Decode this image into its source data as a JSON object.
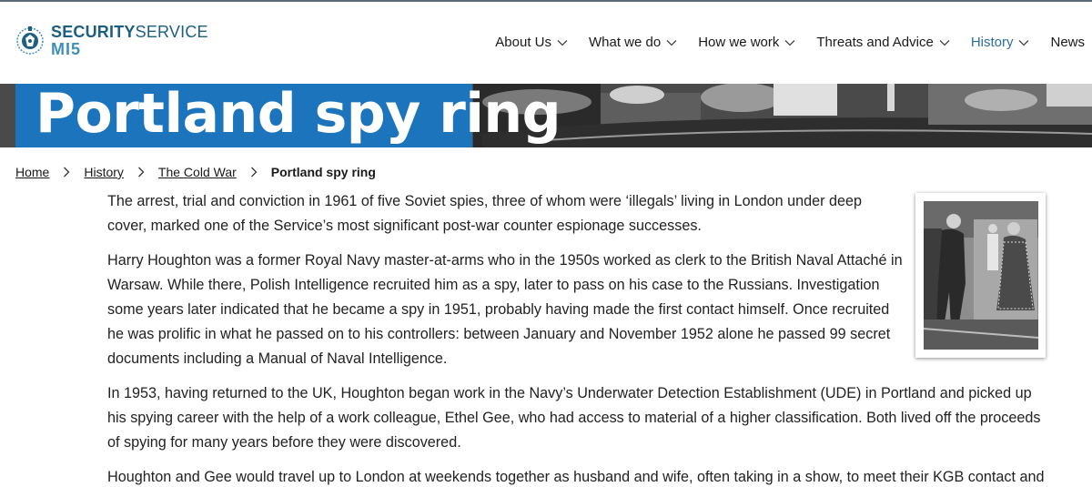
{
  "brand": {
    "line1_bold": "SECURITY",
    "line1_light": "SERVICE",
    "line2": "MI5"
  },
  "nav": {
    "items": [
      {
        "label": "About Us",
        "has_dropdown": true
      },
      {
        "label": "What we do",
        "has_dropdown": true
      },
      {
        "label": "How we work",
        "has_dropdown": true
      },
      {
        "label": "Threats and Advice",
        "has_dropdown": true
      },
      {
        "label": "History",
        "has_dropdown": true,
        "active": true
      },
      {
        "label": "News",
        "has_dropdown": false
      }
    ]
  },
  "hero": {
    "title": "Portland spy ring"
  },
  "breadcrumb": {
    "items": [
      "Home",
      "History",
      "The Cold War"
    ],
    "current": "Portland spy ring"
  },
  "article": {
    "paragraphs": [
      "The arrest, trial and conviction in 1961 of five Soviet spies, three of whom were ‘illegals’ living in London under deep cover, marked one of the Service’s most significant post-war counter espionage successes.",
      "Harry Houghton was a former Royal Navy master-at-arms who in the 1950s worked as clerk to the British Naval Attaché in Warsaw. While there, Polish Intelligence recruited him as a spy, later to pass on his case to the Russians. Investigation some years later indicated that he became a spy in 1951, probably having made the first contact himself. Once recruited he was prolific in what he passed on to his controllers: between January and November 1952 alone he passed 99 secret documents including a Manual of Naval Intelligence.",
      "In 1953, having returned to the UK, Houghton began work in the Navy’s Underwater Detection Establishment (UDE) in Portland and picked up his spying career with the help of a work colleague, Ethel Gee, who had access to material of a higher classification. Both lived off the proceeds of spying for many years before they were discovered.",
      "Houghton and Gee would travel up to London at weekends together as husband and wife, often taking in a show, to meet their KGB contact and"
    ]
  },
  "colors": {
    "brand_dark": "#1c5f80",
    "brand_light": "#3f8fb8",
    "hero_blue": "#1c75bc",
    "nav_active": "#2a6ea0"
  }
}
